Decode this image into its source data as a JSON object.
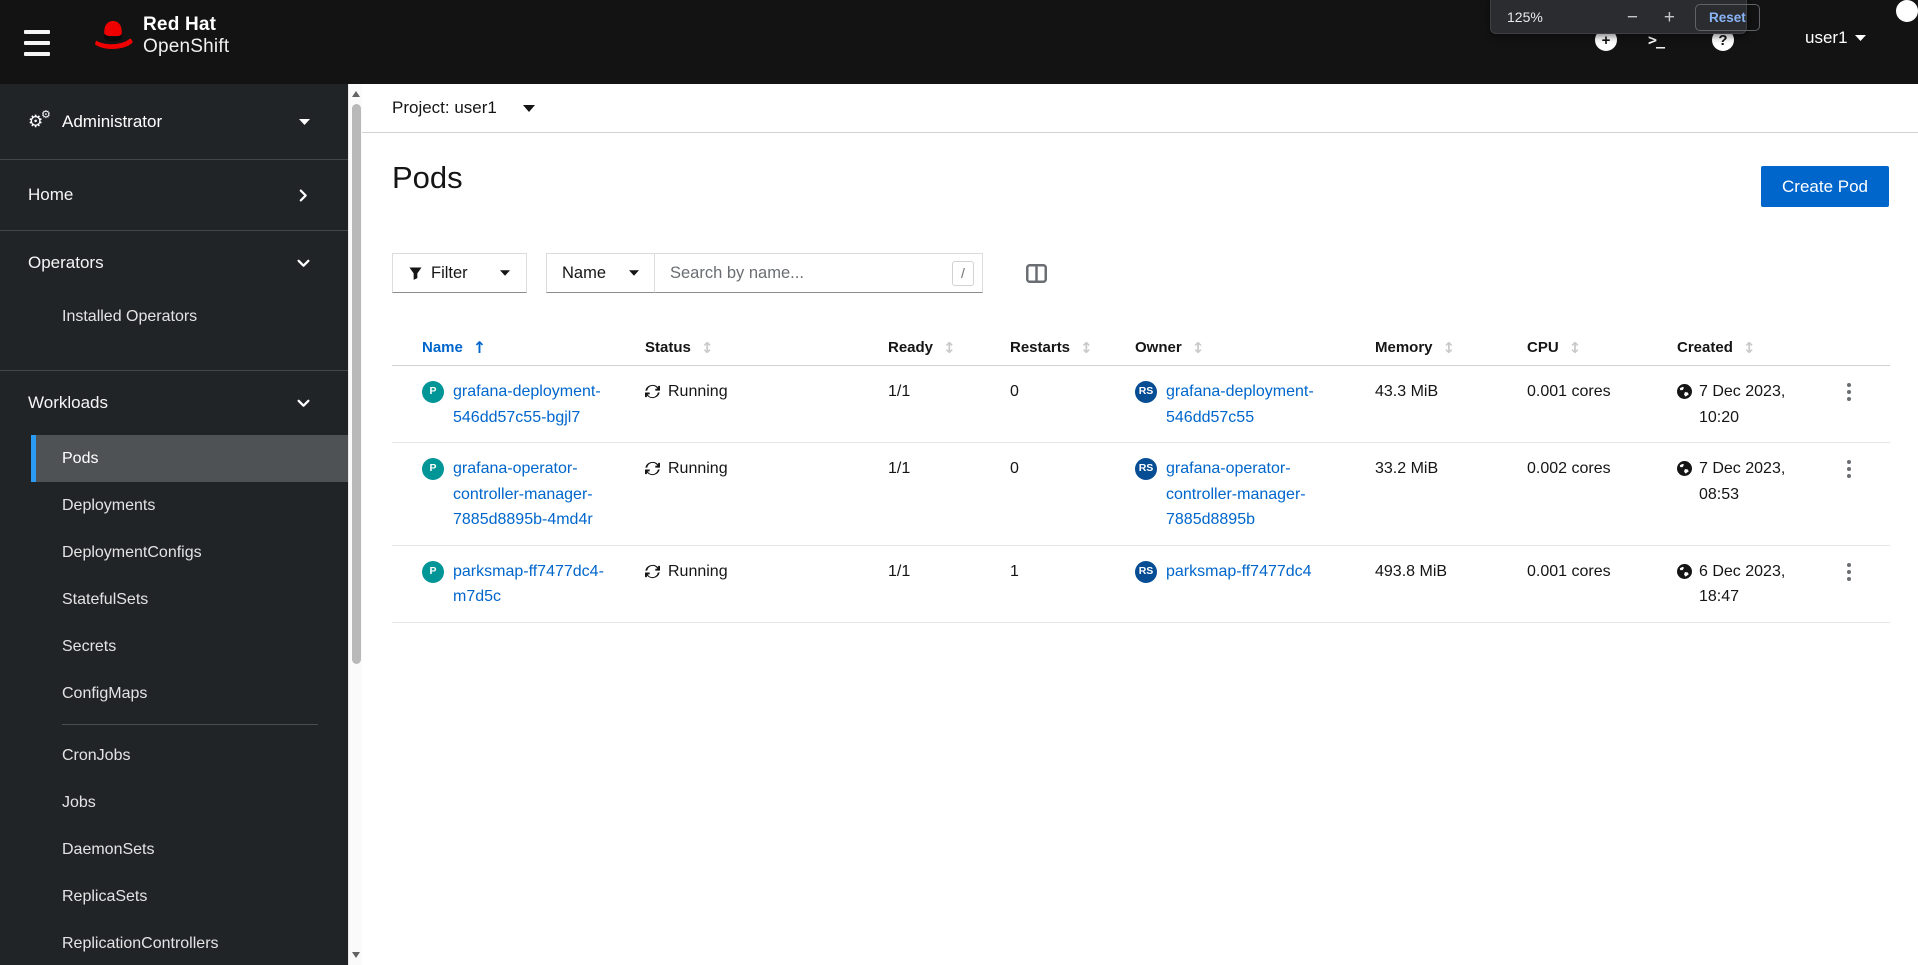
{
  "masthead": {
    "brand_line1": "Red Hat",
    "brand_line2": "OpenShift",
    "plus_icon": "+",
    "terminal_icon": ">_",
    "help_icon": "?",
    "user": "user1"
  },
  "browser_zoom_popup": {
    "level": "125%",
    "minus": "−",
    "plus": "+",
    "reset": "Reset"
  },
  "sidebar": {
    "perspective": "Administrator",
    "home": "Home",
    "operators": "Operators",
    "operators_children": [
      "Installed Operators"
    ],
    "workloads": "Workloads",
    "workloads_children_group1": [
      "Pods",
      "Deployments",
      "DeploymentConfigs",
      "StatefulSets",
      "Secrets",
      "ConfigMaps"
    ],
    "workloads_children_group2": [
      "CronJobs",
      "Jobs",
      "DaemonSets",
      "ReplicaSets",
      "ReplicationControllers"
    ],
    "active_item": "Pods"
  },
  "project_bar": {
    "label": "Project: user1"
  },
  "page_header": {
    "title": "Pods",
    "create_button": "Create Pod"
  },
  "toolbar": {
    "filter": "Filter",
    "attribute": "Name",
    "search_placeholder": "Search by name...",
    "shortcut": "/"
  },
  "table": {
    "columns": [
      "Name",
      "Status",
      "Ready",
      "Restarts",
      "Owner",
      "Memory",
      "CPU",
      "Created"
    ],
    "sorted_by": "Name",
    "rows": [
      {
        "badge": "P",
        "name": "grafana-deployment-546dd57c55-bgjl7",
        "status": "Running",
        "ready": "1/1",
        "restarts": "0",
        "owner_badge": "RS",
        "owner": "grafana-deployment-546dd57c55",
        "memory": "43.3 MiB",
        "cpu": "0.001 cores",
        "created": "7 Dec 2023, 10:20"
      },
      {
        "badge": "P",
        "name": "grafana-operator-controller-manager-7885d8895b-4md4r",
        "status": "Running",
        "ready": "1/1",
        "restarts": "0",
        "owner_badge": "RS",
        "owner": "grafana-operator-controller-manager-7885d8895b",
        "memory": "33.2 MiB",
        "cpu": "0.002 cores",
        "created": "7 Dec 2023, 08:53"
      },
      {
        "badge": "P",
        "name": "parksmap-ff7477dc4-m7d5c",
        "status": "Running",
        "ready": "1/1",
        "restarts": "1",
        "owner_badge": "RS",
        "owner": "parksmap-ff7477dc4",
        "memory": "493.8 MiB",
        "cpu": "0.001 cores",
        "created": "6 Dec 2023, 18:47"
      }
    ]
  },
  "glyphs": {
    "sort_asc": "↑",
    "sort_both": "↕",
    "gear": "⚙"
  },
  "colors": {
    "masthead_bg": "#131313",
    "sidebar_bg": "#212427",
    "brand_red": "#ee0000",
    "accent_blue": "#0066cc",
    "link_blue": "#0066cc",
    "pod_badge": "#009596",
    "replicaset_badge": "#064d94",
    "active_nav_border": "#2b9af3",
    "zoom_reset_blue": "#8ab4f8"
  }
}
